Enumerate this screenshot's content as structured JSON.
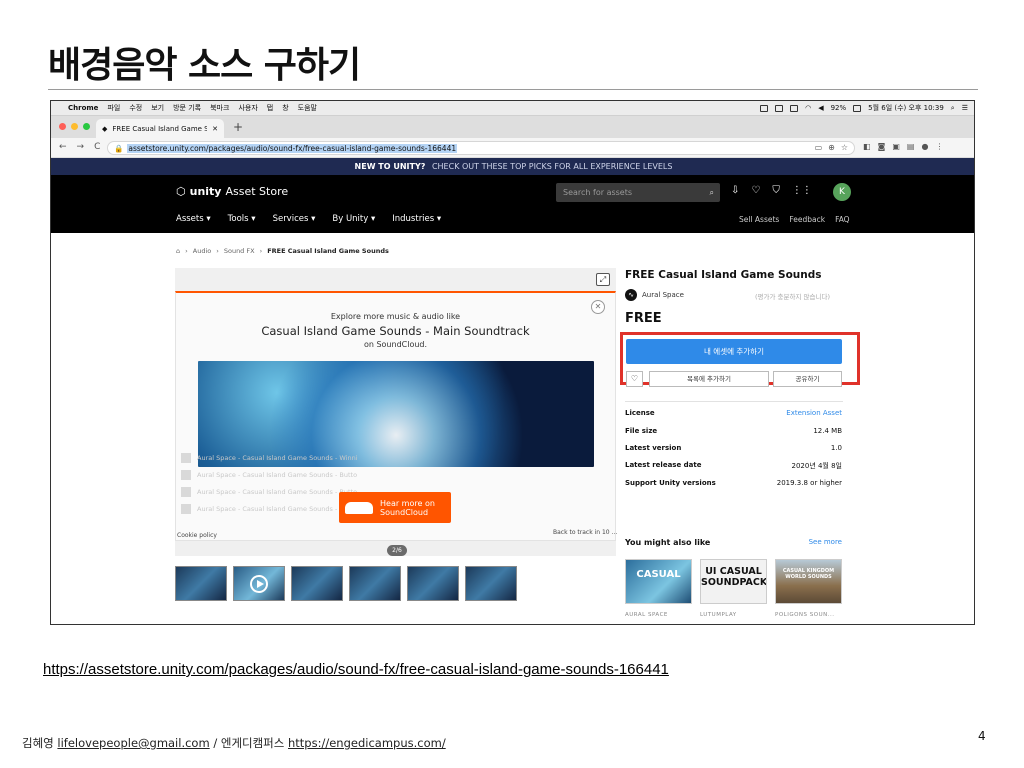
{
  "slide": {
    "title": "배경음악 소스 구하기",
    "url": "https://assetstore.unity.com/packages/audio/sound-fx/free-casual-island-game-sounds-166441",
    "footer": {
      "author": "김혜영",
      "email": "lifelovepeople@gmail.com",
      "separator": "/",
      "org": "엔게디캠퍼스",
      "site": "https://engedicampus.com/"
    },
    "page_number": "4"
  },
  "mac_menubar": {
    "apple_icon": "apple-icon",
    "app_name": "Chrome",
    "menus": [
      "파일",
      "수정",
      "보기",
      "방문 기록",
      "북마크",
      "사용자",
      "탭",
      "창",
      "도움말"
    ],
    "battery": "92%",
    "datetime": "5월 6일 (수) 오후 10:39"
  },
  "browser": {
    "tab_title": "FREE Casual Island Game Sou",
    "tab_close": "✕",
    "new_tab": "+",
    "address": "assetstore.unity.com/packages/audio/sound-fx/free-casual-island-game-sounds-166441",
    "nav": {
      "back": "←",
      "forward": "→",
      "reload": "C"
    },
    "lock_icon": "lock-icon"
  },
  "promo_banner": {
    "strong": "NEW TO UNITY?",
    "text": "CHECK OUT THESE TOP PICKS FOR ALL EXPERIENCE LEVELS"
  },
  "store_header": {
    "logo_bold": "unity",
    "logo_text": "Asset Store",
    "search_placeholder": "Search for assets",
    "avatar_initial": "K",
    "nav": [
      "Assets",
      "Tools",
      "Services",
      "By Unity",
      "Industries"
    ],
    "nav_right": [
      "Sell Assets",
      "Feedback",
      "FAQ"
    ]
  },
  "breadcrumb": [
    "Audio",
    "Sound FX",
    "FREE Casual Island Game Sounds"
  ],
  "soundcloud": {
    "line1": "Explore more music & audio like",
    "line2": "Casual Island Game Sounds - Main Soundtrack",
    "line3": "on SoundCloud.",
    "close": "✕",
    "hear_more_1": "Hear more on",
    "hear_more_2": "SoundCloud",
    "tracks": [
      "Aural Space - Casual Island Game Sounds - Winni",
      "Aural Space - Casual Island Game Sounds - Butto",
      "Aural Space - Casual Island Game Sounds - Butto",
      "Aural Space - Casual Island Game Sounds - Butto"
    ],
    "cookie_policy": "Cookie policy",
    "back_to_track": "Back to track in 10 ..."
  },
  "gallery": {
    "pager": "2/6",
    "expand_icon": "expand-icon"
  },
  "product": {
    "title": "FREE Casual Island Game Sounds",
    "publisher": "Aural Space",
    "rating_note": "(평가가 충분하지 않습니다)",
    "price": "FREE",
    "add_button": "내 에셋에 추가하기",
    "heart": "♡",
    "list_button": "목록에 추가하기",
    "share_button": "공유하기",
    "info": [
      {
        "key": "License",
        "value": "Extension Asset"
      },
      {
        "key": "File size",
        "value": "12.4 MB"
      },
      {
        "key": "Latest version",
        "value": "1.0"
      },
      {
        "key": "Latest release date",
        "value": "2020년 4월 8일"
      },
      {
        "key": "Support Unity versions",
        "value": "2019.3.8 or higher"
      }
    ]
  },
  "also_like": {
    "title": "You might also like",
    "see_more": "See more",
    "items": [
      {
        "thumb_text": "CASUAL",
        "caption": "AURAL SPACE"
      },
      {
        "thumb_text": "UI CASUAL SOUNDPACK",
        "caption": "LUTUMPLAY"
      },
      {
        "thumb_text": "CASUAL KINGDOM WORLD SOUNDS",
        "caption": "POLIGONS SOUN..."
      }
    ]
  },
  "colors": {
    "accent_blue": "#2f8ae8",
    "highlight_red": "#e0322a",
    "soundcloud_orange": "#ff5500",
    "unity_header": "#000000",
    "promo_banner": "#1f2a52"
  }
}
